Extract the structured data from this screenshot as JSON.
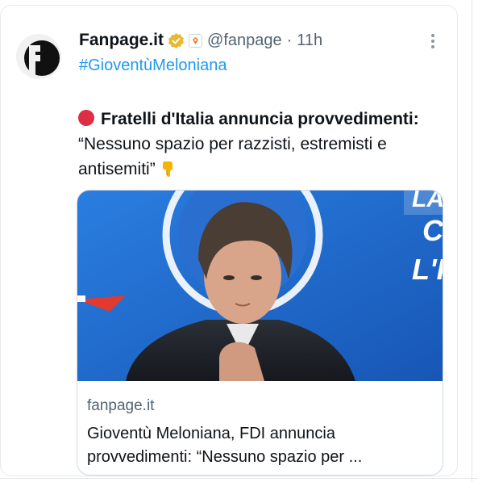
{
  "account": {
    "display_name": "Fanpage.it",
    "handle": "@fanpage",
    "separator": "·",
    "time": "11h",
    "hashtag": "#GioventùMeloniana"
  },
  "tweet": {
    "headline_bold": "Fratelli d'Italia annuncia provvedimenti:",
    "quote": " “Nessuno spazio per razzisti, estremisti e antisemiti”",
    "lead_emoji": "red-circle-icon",
    "trail_emoji": "hand-pointing-down-icon"
  },
  "link_card": {
    "domain": "fanpage.it",
    "title": "Gioventù Meloniana, FDI annuncia provvedimenti: “Nessuno spazio per ..."
  },
  "colors": {
    "link_blue": "#1d9bf0",
    "muted_gray": "#536471",
    "verified_gold": "#e8b830",
    "image_blue": "#1f6fd0"
  }
}
